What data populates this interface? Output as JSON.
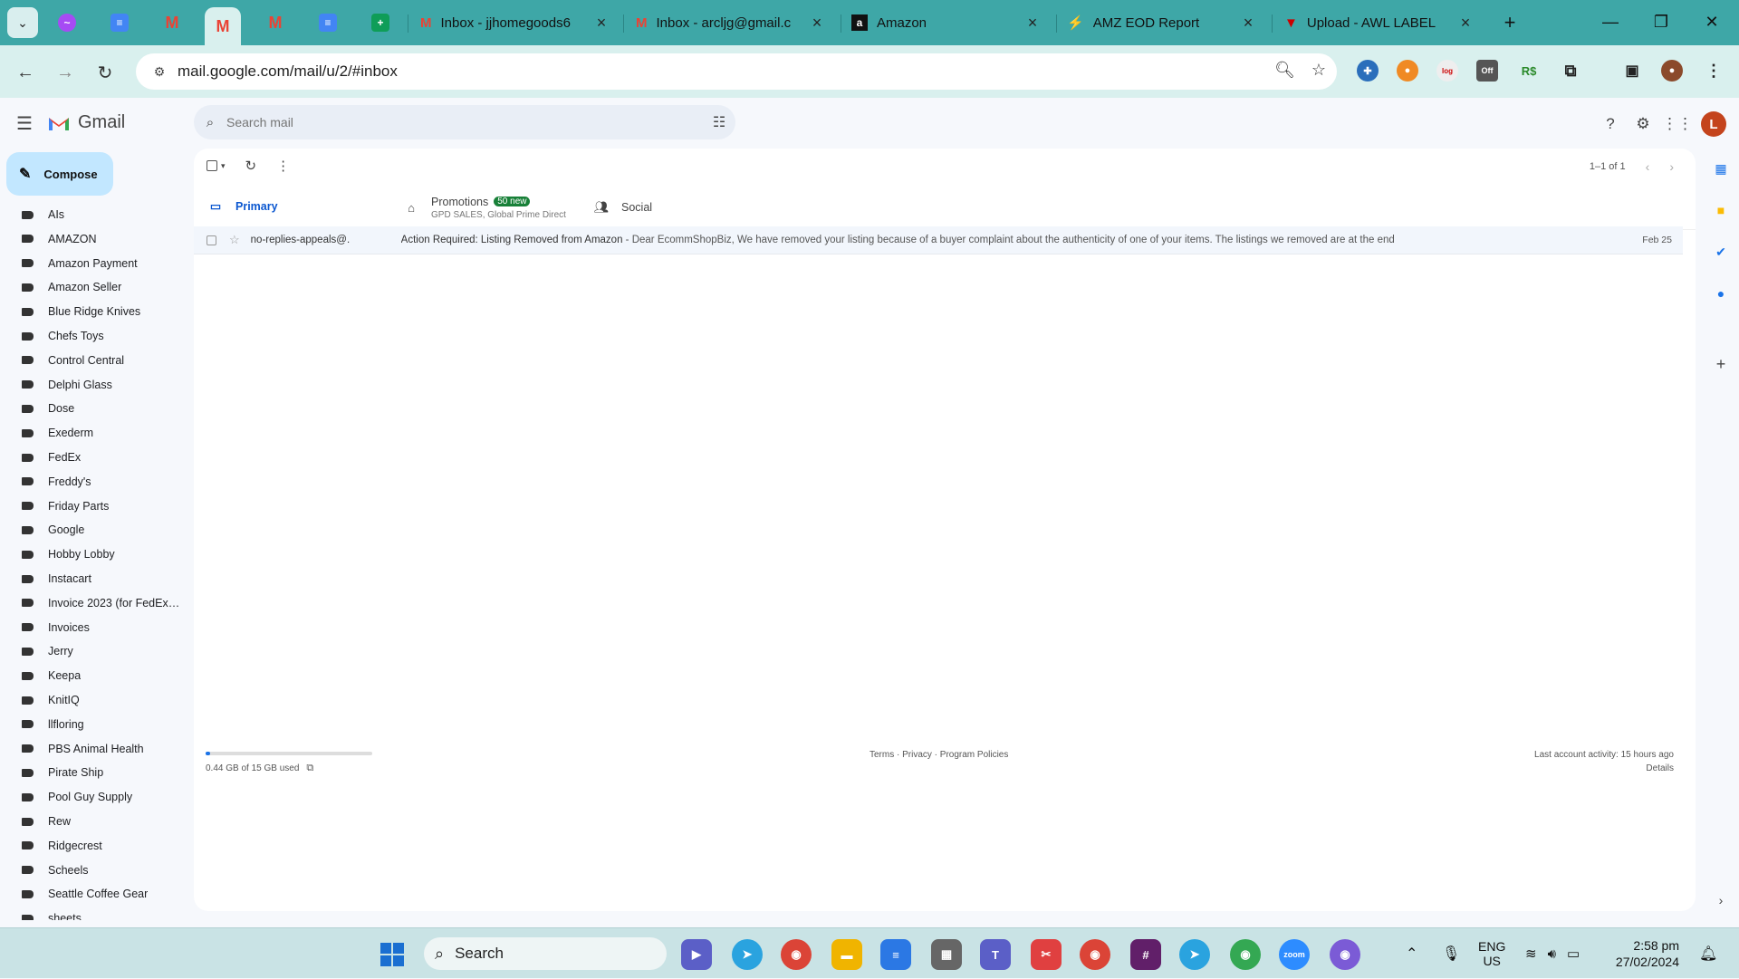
{
  "browser": {
    "tabs": [
      {
        "label": "Inbox - jjhomegoods6",
        "icon": "gmail-icon"
      },
      {
        "label": "Inbox - arcljg@gmail.c",
        "icon": "gmail-icon"
      },
      {
        "label": "Amazon",
        "icon": "amazon-icon"
      },
      {
        "label": "AMZ EOD Report",
        "icon": "report-icon"
      },
      {
        "label": "Upload - AWL LABEL",
        "icon": "upload-icon"
      }
    ],
    "url": "mail.google.com/mail/u/2/#inbox"
  },
  "gmail": {
    "app_name": "Gmail",
    "search_placeholder": "Search mail",
    "avatar_letter": "L",
    "compose_label": "Compose",
    "labels": [
      "AIs",
      "AMAZON",
      "Amazon Payment",
      "Amazon Seller",
      "Blue Ridge Knives",
      "Chefs Toys",
      "Control Central",
      "Delphi Glass",
      "Dose",
      "Exederm",
      "FedEx",
      "Freddy's",
      "Friday Parts",
      "Google",
      "Hobby Lobby",
      "Instacart",
      "Invoice 2023 (for FedEx ...",
      "Invoices",
      "Jerry",
      "Keepa",
      "KnitIQ",
      "llfloring",
      "PBS Animal Health",
      "Pirate Ship",
      "Pool Guy Supply",
      "Rew",
      "Ridgecrest",
      "Scheels",
      "Seattle Coffee Gear",
      "sheets"
    ],
    "pager": "1–1 of 1",
    "tabs": {
      "primary": "Primary",
      "promotions": "Promotions",
      "promotions_badge": "50 new",
      "promotions_sub": "GPD SALES, Global Prime Direct",
      "social": "Social"
    },
    "mail": {
      "from": "no-replies-appeals@.",
      "subject": "Action Required: Listing Removed from Amazon",
      "snippet": " - Dear EcommShopBiz, We have removed your listing because of a buyer complaint about the authenticity of one of your items. The listings we removed are at the end",
      "date": "Feb 25"
    },
    "footer": {
      "storage": "0.44 GB of 15 GB used",
      "storage_fraction": 0.029,
      "links": "Terms · Privacy · Program Policies",
      "activity": "Last account activity: 15 hours ago",
      "details": "Details"
    }
  },
  "taskbar": {
    "search_label": "Search",
    "lang_line1": "ENG",
    "lang_line2": "US",
    "time": "2:58 pm",
    "date": "27/02/2024"
  }
}
